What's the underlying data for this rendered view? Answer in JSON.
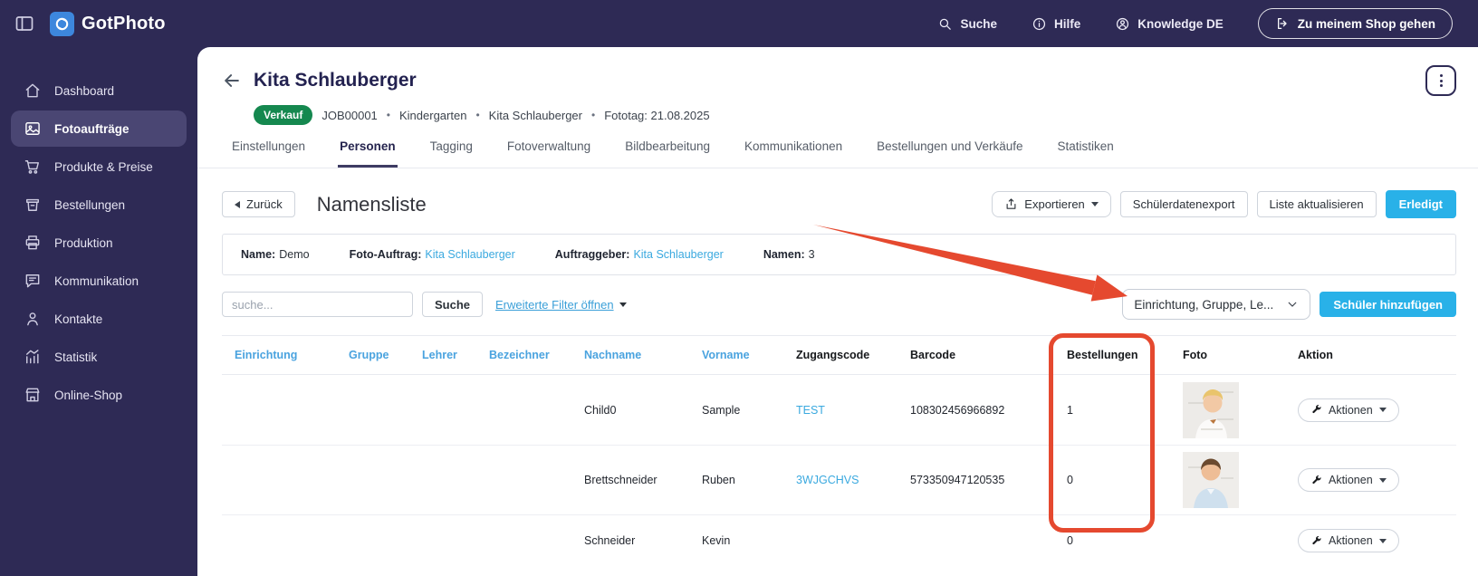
{
  "ui": {
    "bullet": "•"
  },
  "topbar": {
    "brand": "GotPhoto",
    "nav": [
      {
        "label": "Suche"
      },
      {
        "label": "Hilfe"
      },
      {
        "label": "Knowledge DE"
      }
    ],
    "shop_button": "Zu meinem Shop gehen"
  },
  "sidebar": {
    "items": [
      {
        "label": "Dashboard"
      },
      {
        "label": "Fotoaufträge"
      },
      {
        "label": "Produkte & Preise"
      },
      {
        "label": "Bestellungen"
      },
      {
        "label": "Produktion"
      },
      {
        "label": "Kommunikation"
      },
      {
        "label": "Kontakte"
      },
      {
        "label": "Statistik"
      },
      {
        "label": "Online-Shop"
      }
    ]
  },
  "header": {
    "title": "Kita Schlauberger",
    "badge": "Verkauf",
    "meta": {
      "job_id": "JOB00001",
      "category": "Kindergarten",
      "client": "Kita Schlauberger",
      "fototag": "Fototag: 21.08.2025"
    },
    "tabs": [
      "Einstellungen",
      "Personen",
      "Tagging",
      "Fotoverwaltung",
      "Bildbearbeitung",
      "Kommunikationen",
      "Bestellungen und Verkäufe",
      "Statistiken"
    ]
  },
  "toolbar": {
    "back_label": "Zurück",
    "page_title": "Namensliste",
    "export_label": "Exportieren",
    "student_export_label": "Schülerdatenexport",
    "refresh_label": "Liste aktualisieren",
    "done_label": "Erledigt"
  },
  "infobar": {
    "name_label": "Name:",
    "name_value": "Demo",
    "job_label": "Foto-Auftrag:",
    "job_value": "Kita Schlauberger",
    "client_label": "Auftraggeber:",
    "client_value": "Kita Schlauberger",
    "count_label": "Namen:",
    "count_value": "3"
  },
  "filters": {
    "search_placeholder": "suche...",
    "search_button": "Suche",
    "advanced_link": "Erweiterte Filter öffnen",
    "column_select_value": "Einrichtung, Gruppe, Le...",
    "add_student_button": "Schüler hinzufügen"
  },
  "table": {
    "columns": [
      {
        "label": "Einrichtung",
        "sortable": true
      },
      {
        "label": "Gruppe",
        "sortable": true
      },
      {
        "label": "Lehrer",
        "sortable": true
      },
      {
        "label": "Bezeichner",
        "sortable": true
      },
      {
        "label": "Nachname",
        "sortable": true
      },
      {
        "label": "Vorname",
        "sortable": true
      },
      {
        "label": "Zugangscode",
        "sortable": false
      },
      {
        "label": "Barcode",
        "sortable": false
      },
      {
        "label": "Bestellungen",
        "sortable": false
      },
      {
        "label": "Foto",
        "sortable": false
      },
      {
        "label": "Aktion",
        "sortable": false
      }
    ],
    "rows": [
      {
        "einrichtung": "",
        "gruppe": "",
        "lehrer": "",
        "bezeichner": "",
        "nachname": "Child0",
        "vorname": "Sample",
        "zugangscode": "TEST",
        "barcode": "108302456966892",
        "bestellungen": "1",
        "aktion_label": "Aktionen"
      },
      {
        "einrichtung": "",
        "gruppe": "",
        "lehrer": "",
        "bezeichner": "",
        "nachname": "Brettschneider",
        "vorname": "Ruben",
        "zugangscode": "3WJGCHVS",
        "barcode": "573350947120535",
        "bestellungen": "0",
        "aktion_label": "Aktionen"
      },
      {
        "einrichtung": "",
        "gruppe": "",
        "lehrer": "",
        "bezeichner": "",
        "nachname": "Schneider",
        "vorname": "Kevin",
        "zugangscode": "",
        "barcode": "",
        "bestellungen": "0",
        "aktion_label": "Aktionen"
      }
    ]
  },
  "colors": {
    "navy": "#2e2a55",
    "accent_blue": "#29b1e8",
    "link_blue": "#3aa9df",
    "badge_green": "#15884f",
    "annotation_red": "#e5492f"
  }
}
